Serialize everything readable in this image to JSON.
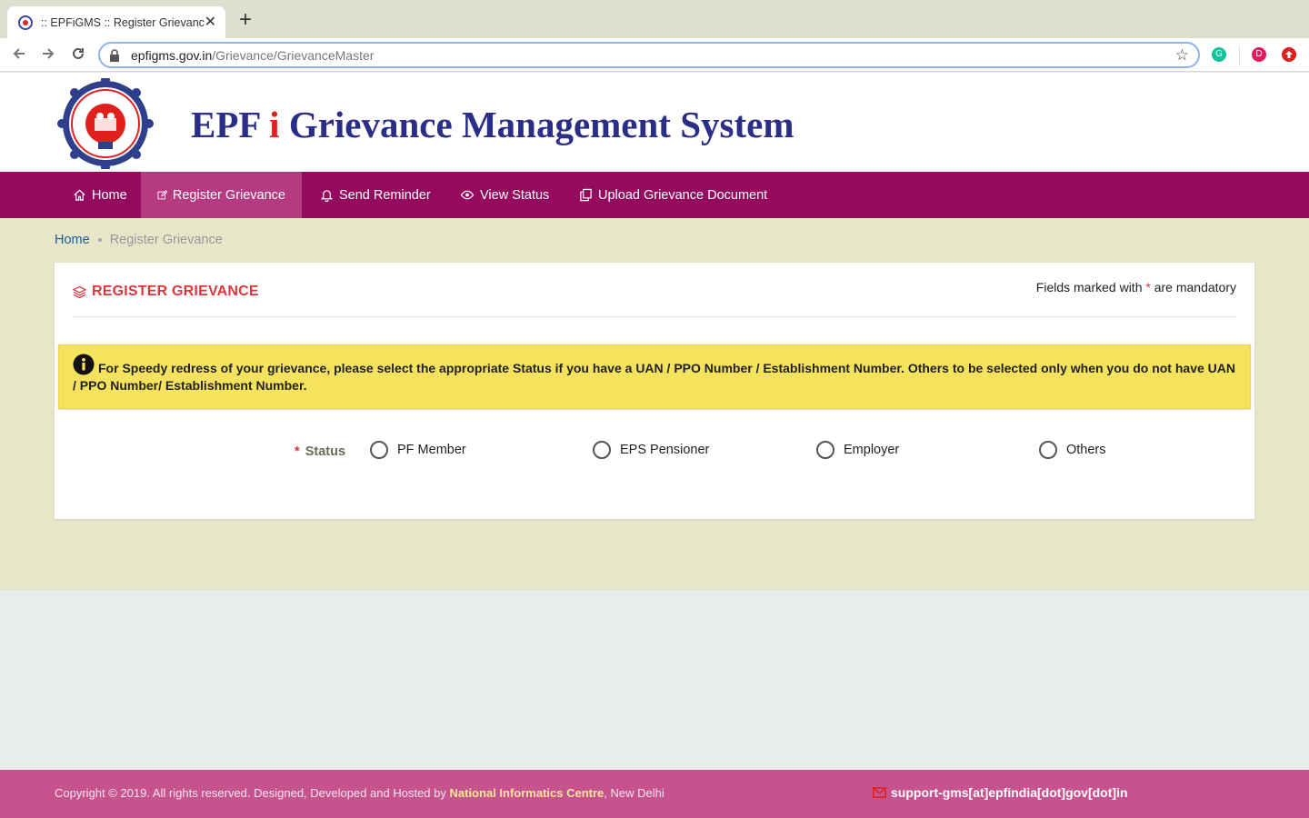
{
  "browser": {
    "tab_title": ":: EPFiGMS :: Register Grievanc",
    "close_symbol": "✕",
    "new_tab_symbol": "+",
    "url_domain": "epfigms.gov.in",
    "url_path": "/Grievance/GrievanceMaster",
    "profile_initial": "D",
    "grammarly_letter": "G"
  },
  "site": {
    "title_pre": "EPF ",
    "title_i": "i",
    "title_post": " Grievance Management System"
  },
  "nav": {
    "home": "Home",
    "register": "Register Grievance",
    "reminder": "Send Reminder",
    "status": "View Status",
    "upload": "Upload Grievance Document"
  },
  "breadcrumb": {
    "home": "Home",
    "current": "Register Grievance"
  },
  "form": {
    "title": "REGISTER GRIEVANCE",
    "mandatory_pre": "Fields marked with ",
    "mandatory_ast": "*",
    "mandatory_post": " are mandatory",
    "alert_text": "For Speedy redress of your grievance, please select the appropriate Status if you have a UAN / PPO Number / Establishment Number. Others to be selected only when you do not have UAN / PPO Number/ Establishment Number.",
    "status_ast": "*",
    "status_label": "Status",
    "options": [
      "PF Member",
      "EPS Pensioner",
      "Employer",
      "Others"
    ]
  },
  "footer": {
    "copyright_pre": "Copyright © 2019. All rights reserved. Designed, Developed and Hosted by ",
    "nic": "National Informatics Centre",
    "copyright_post": ", New Delhi",
    "email": "support-gms[at]epfindia[dot]gov[dot]in"
  },
  "colors": {
    "nav_bg": "#930a5f",
    "nav_active": "#b63a7f",
    "title_blue": "#2a2e86",
    "accent_red": "#e0353b",
    "alert_yellow": "#f5e25d",
    "footer_bg": "#c7538e",
    "content_bg": "#e7e6c8"
  }
}
